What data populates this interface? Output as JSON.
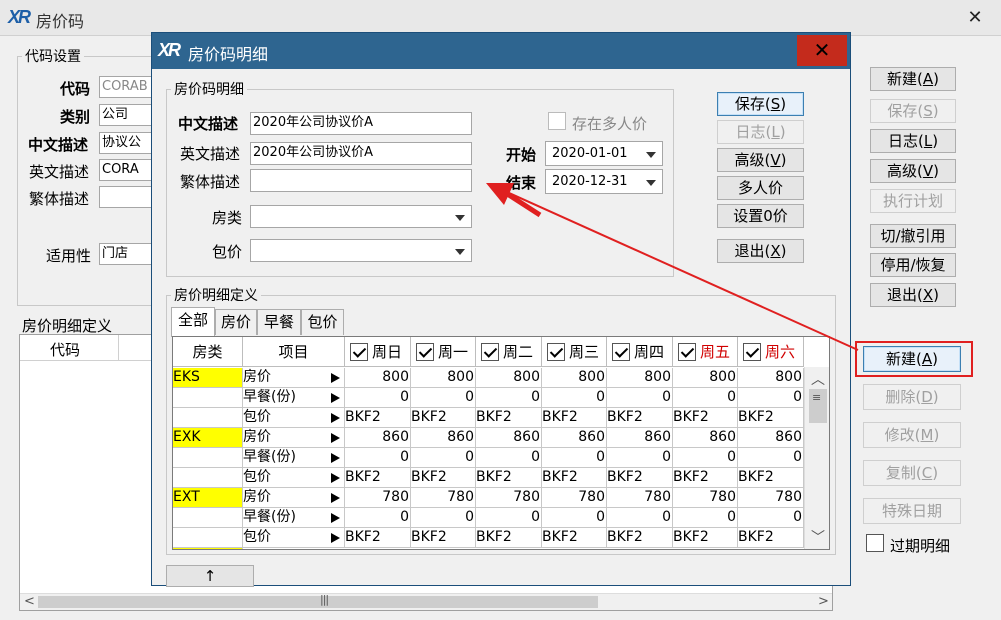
{
  "main": {
    "title": "房价码",
    "code_settings": {
      "legend": "代码设置",
      "code_label": "代码",
      "code_value": "CORAB",
      "type_label": "类别",
      "type_value": "公司",
      "cn_desc_label": "中文描述",
      "cn_desc_value": "协议公",
      "en_desc_label": "英文描述",
      "en_desc_value": "CORA",
      "tc_desc_label": "繁体描述",
      "tc_desc_value": "",
      "applicability_label": "适用性",
      "applicability_value": "门店"
    },
    "detail_def": {
      "legend": "房价明细定义",
      "col_code": "代码"
    },
    "buttons_top": {
      "new": "新建",
      "new_key": "A",
      "save": "保存",
      "save_key": "S",
      "log": "日志",
      "log_key": "L",
      "advanced": "高级",
      "advanced_key": "V",
      "exec_plan": "执行计划",
      "switch_ref": "切/撤引用",
      "toggle": "停用/恢复",
      "exit": "退出",
      "exit_key": "X"
    },
    "buttons_bottom": {
      "new": "新建",
      "new_key": "A",
      "delete": "删除",
      "delete_key": "D",
      "modify": "修改",
      "modify_key": "M",
      "copy": "复制",
      "copy_key": "C",
      "special_date": "特殊日期",
      "expired_detail": "过期明细"
    }
  },
  "dialog": {
    "title": "房价码明细",
    "group_label": "房价码明细",
    "cn_desc_label": "中文描述",
    "cn_desc_value": "2020年公司协议价A",
    "en_desc_label": "英文描述",
    "en_desc_value": "2020年公司协议价A",
    "tc_desc_label": "繁体描述",
    "tc_desc_value": "",
    "room_type_label": "房类",
    "room_type_value": "",
    "package_label": "包价",
    "package_value": "",
    "multi_price_label": "存在多人价",
    "start_label": "开始",
    "start_value": "2020-01-01",
    "end_label": "结束",
    "end_value": "2020-12-31",
    "buttons": {
      "save": "保存",
      "save_key": "S",
      "log": "日志",
      "log_key": "L",
      "advanced": "高级",
      "advanced_key": "V",
      "multi": "多人价",
      "set_zero": "设置0价",
      "exit": "退出",
      "exit_key": "X"
    },
    "grid_group_label": "房价明细定义",
    "tabs": [
      "全部",
      "房价",
      "早餐",
      "包价"
    ],
    "grid": {
      "col_room_type": "房类",
      "col_item": "项目",
      "days": [
        "周日",
        "周一",
        "周二",
        "周三",
        "周四",
        "周五",
        "周六"
      ],
      "rows": [
        {
          "room": "EKS",
          "item": "房价",
          "vals": [
            "800",
            "800",
            "800",
            "800",
            "800",
            "800",
            "800"
          ]
        },
        {
          "room": "",
          "item": "早餐(份)",
          "vals": [
            "0",
            "0",
            "0",
            "0",
            "0",
            "0",
            "0"
          ]
        },
        {
          "room": "",
          "item": "包价",
          "vals": [
            "BKF2",
            "BKF2",
            "BKF2",
            "BKF2",
            "BKF2",
            "BKF2",
            "BKF2"
          ]
        },
        {
          "room": "EXK",
          "item": "房价",
          "vals": [
            "860",
            "860",
            "860",
            "860",
            "860",
            "860",
            "860"
          ]
        },
        {
          "room": "",
          "item": "早餐(份)",
          "vals": [
            "0",
            "0",
            "0",
            "0",
            "0",
            "0",
            "0"
          ]
        },
        {
          "room": "",
          "item": "包价",
          "vals": [
            "BKF2",
            "BKF2",
            "BKF2",
            "BKF2",
            "BKF2",
            "BKF2",
            "BKF2"
          ]
        },
        {
          "room": "EXT",
          "item": "房价",
          "vals": [
            "780",
            "780",
            "780",
            "780",
            "780",
            "780",
            "780"
          ]
        },
        {
          "room": "",
          "item": "早餐(份)",
          "vals": [
            "0",
            "0",
            "0",
            "0",
            "0",
            "0",
            "0"
          ]
        },
        {
          "room": "",
          "item": "包价",
          "vals": [
            "BKF2",
            "BKF2",
            "BKF2",
            "BKF2",
            "BKF2",
            "BKF2",
            "BKF2"
          ]
        }
      ]
    },
    "up_arrow": "↑"
  },
  "colors": {
    "dialog_title": "#2e6590",
    "close_red": "#c42b1c",
    "highlight_red": "#e02020",
    "weekend_red": "#d00000",
    "room_yellow": "#ffff00"
  }
}
